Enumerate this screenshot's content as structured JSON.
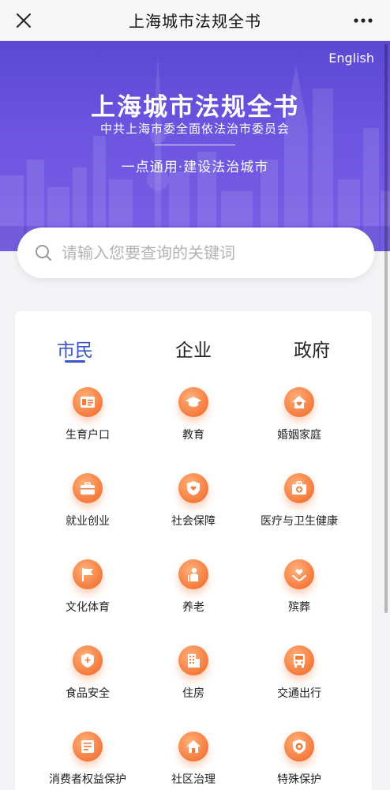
{
  "navbar": {
    "title": "上海城市法规全书"
  },
  "hero": {
    "lang_link": "English",
    "title": "上海城市法规全书",
    "subtitle": "中共上海市委全面依法治市委员会",
    "slogan": "一点通用·建设法治城市"
  },
  "search": {
    "placeholder": "请输入您要查询的关键词"
  },
  "tabs": [
    {
      "label": "市民",
      "active": true
    },
    {
      "label": "企业",
      "active": false
    },
    {
      "label": "政府",
      "active": false
    }
  ],
  "categories": [
    {
      "label": "生育户口",
      "icon": "id-card-icon"
    },
    {
      "label": "教育",
      "icon": "graduation-cap-icon"
    },
    {
      "label": "婚姻家庭",
      "icon": "home-heart-icon"
    },
    {
      "label": "就业创业",
      "icon": "briefcase-icon"
    },
    {
      "label": "社会保障",
      "icon": "shield-hands-icon"
    },
    {
      "label": "医疗与卫生健康",
      "icon": "medical-kit-icon"
    },
    {
      "label": "文化体育",
      "icon": "flag-icon"
    },
    {
      "label": "养老",
      "icon": "elder-person-icon"
    },
    {
      "label": "殡葬",
      "icon": "hands-heart-icon"
    },
    {
      "label": "食品安全",
      "icon": "shield-plus-icon"
    },
    {
      "label": "住房",
      "icon": "building-icon"
    },
    {
      "label": "交通出行",
      "icon": "bus-icon"
    },
    {
      "label": "消费者权益保护",
      "icon": "document-icon"
    },
    {
      "label": "社区治理",
      "icon": "house-icon"
    },
    {
      "label": "特殊保护",
      "icon": "protect-badge-icon"
    }
  ],
  "colors": {
    "hero": "#6a52dd",
    "accent_blue": "#3a56c8",
    "icon_orange": "#f57a3c"
  }
}
